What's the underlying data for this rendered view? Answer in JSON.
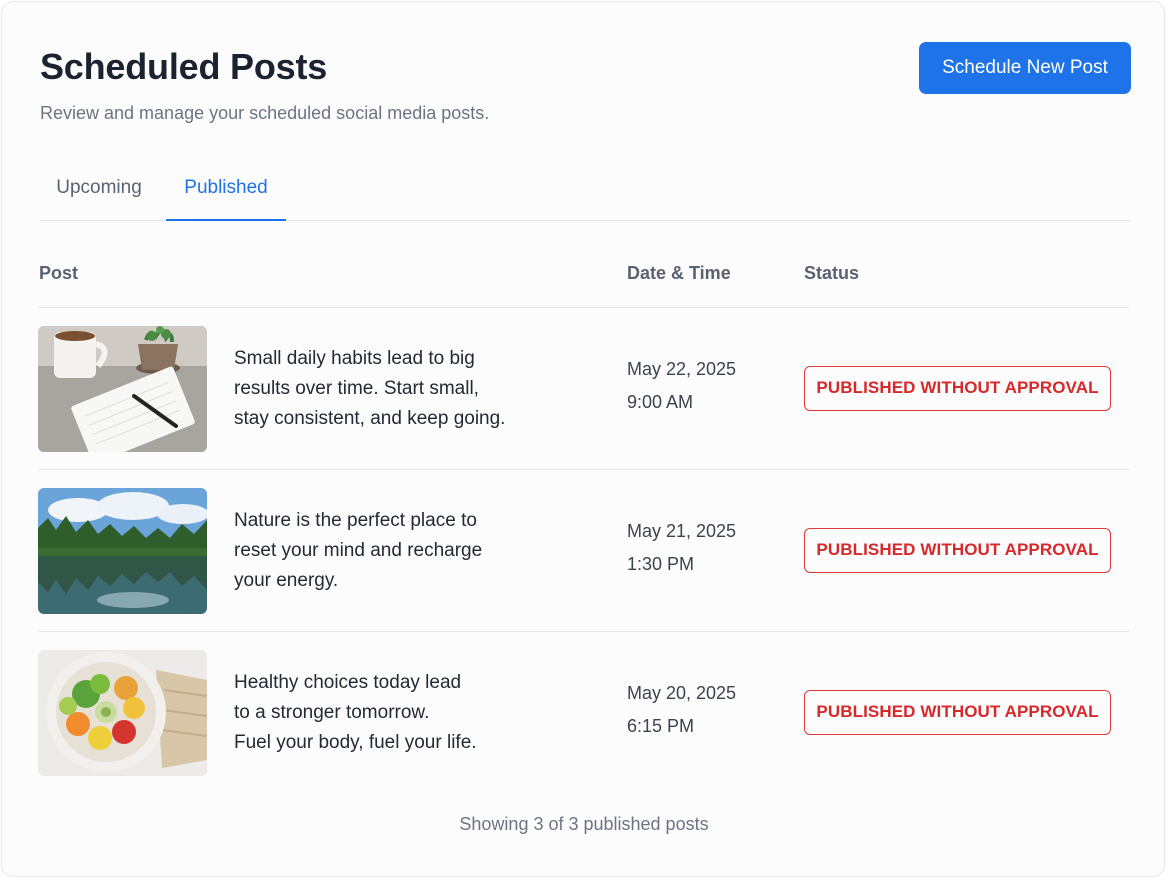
{
  "header": {
    "title": "Scheduled Posts",
    "subtitle": "Review and manage your scheduled social media posts.",
    "primary_button_label": "Schedule New Post"
  },
  "tabs": [
    {
      "label": "Upcoming",
      "active": false
    },
    {
      "label": "Published",
      "active": true
    }
  ],
  "table": {
    "columns": [
      "Post",
      "Date & Time",
      "Status"
    ],
    "rows": [
      {
        "thumbnail": "coffee-notebook-image",
        "text": "Small daily habits lead to big\nresults over time. Start small,\nstay consistent, and keep going.",
        "date": "May 22, 2025",
        "time": "9:00 AM",
        "status": "PUBLISHED WITHOUT APPROVAL"
      },
      {
        "thumbnail": "forest-lake-image",
        "text": "Nature is the perfect place to\nreset your mind and recharge\nyour energy.",
        "date": "May 21, 2025",
        "time": "1:30 PM",
        "status": "PUBLISHED WITHOUT APPROVAL"
      },
      {
        "thumbnail": "salad-bowl-image",
        "text": "Healthy choices today lead\nto a stronger tomorrow.\nFuel your body, fuel your life.",
        "date": "May 20, 2025",
        "time": "6:15 PM",
        "status": "PUBLISHED WITHOUT APPROVAL"
      }
    ]
  },
  "footer": {
    "summary": "Showing 3 of 3 published posts"
  },
  "colors": {
    "accent": "#1f73e8",
    "status_error": "#d7282a",
    "text_primary": "#1b2230",
    "text_muted": "#6b7483"
  }
}
